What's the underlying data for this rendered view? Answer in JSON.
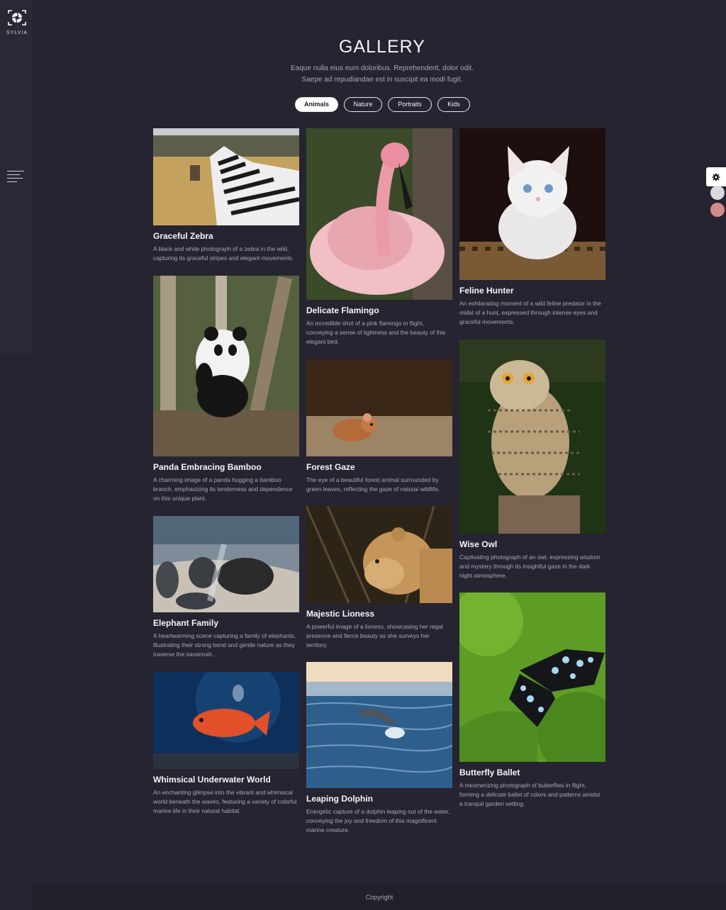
{
  "brand": {
    "name": "SYLVIA",
    "logo_icon": "camera-aperture-icon"
  },
  "header": {
    "title": "GALLERY",
    "subtitle_line1": "Eaque nulla eius eum doloribus. Reprehenderit, dolor odit.",
    "subtitle_line2": "Saepe ad repudiandae est in suscipit ea modi fugit."
  },
  "filters": {
    "active": "Animals",
    "items": [
      {
        "label": "Animals"
      },
      {
        "label": "Nature"
      },
      {
        "label": "Portraits"
      },
      {
        "label": "Kids"
      }
    ]
  },
  "gallery": [
    {
      "title": "Graceful Zebra",
      "description": "A black and white photograph of a zebra in the wild, capturing its graceful stripes and elegant movements."
    },
    {
      "title": "Panda Embracing Bamboo",
      "description": "A charming image of a panda hugging a bamboo branch, emphasizing its tenderness and dependence on this unique plant."
    },
    {
      "title": "Elephant Family",
      "description": "A heartwarming scene capturing a family of elephants, illustrating their strong bond and gentle nature as they traverse the savannah."
    },
    {
      "title": "Whimsical Underwater World",
      "description": "An enchanting glimpse into the vibrant and whimsical world beneath the waves, featuring a variety of colorful marine life in their natural habitat."
    },
    {
      "title": "Delicate Flamingo",
      "description": "An incredible shot of a pink flamingo in flight, conveying a sense of lightness and the beauty of this elegant bird."
    },
    {
      "title": "Forest Gaze",
      "description": "The eye of a beautiful forest animal surrounded by green leaves, reflecting the gaze of natural wildlife."
    },
    {
      "title": "Majestic Lioness",
      "description": "A powerful image of a lioness, showcasing her regal presence and fierce beauty as she surveys her territory."
    },
    {
      "title": "Leaping Dolphin",
      "description": "Energetic capture of a dolphin leaping out of the water, conveying the joy and freedom of this magnificent marine creature."
    },
    {
      "title": "Feline Hunter",
      "description": "An exhilarating moment of a wild feline predator in the midst of a hunt, expressed through intense eyes and graceful movements."
    },
    {
      "title": "Wise Owl",
      "description": "Captivating photograph of an owl, expressing wisdom and mystery through its insightful gaze in the dark night atmosphere."
    },
    {
      "title": "Butterfly Ballet",
      "description": "A mesmerizing photograph of butterflies in flight, forming a delicate ballet of colors and patterns amidst a tranquil garden setting."
    }
  ],
  "tools": {
    "settings_icon": "gear-icon"
  },
  "footer": {
    "text": "Copyright"
  },
  "colors": {
    "background": "#262430",
    "text_muted": "#a9a7b3",
    "active_filter_bg": "#ffffff"
  }
}
